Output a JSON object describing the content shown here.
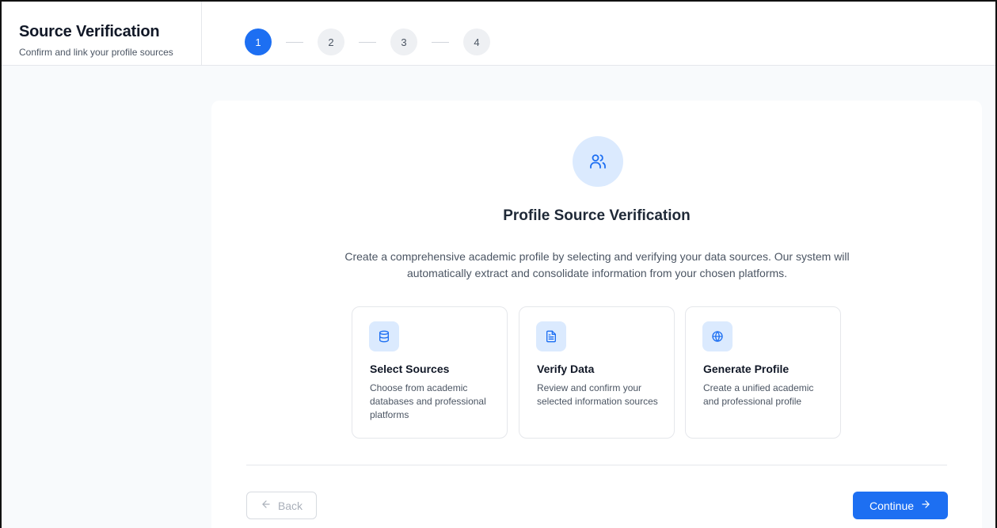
{
  "header": {
    "title": "Source Verification",
    "subtitle": "Confirm and link your profile sources"
  },
  "stepper": {
    "steps": [
      "1",
      "2",
      "3",
      "4"
    ],
    "active_step": "1"
  },
  "intro": {
    "icon": "users-icon",
    "title": "Profile Source Verification",
    "description": "Create a comprehensive academic profile by selecting and verifying your data sources. Our system will automatically extract and consolidate information from your chosen platforms."
  },
  "features": [
    {
      "icon": "database-icon",
      "title": "Select Sources",
      "description": "Choose from academic databases and professional platforms"
    },
    {
      "icon": "document-icon",
      "title": "Verify Data",
      "description": "Review and confirm your selected information sources"
    },
    {
      "icon": "globe-icon",
      "title": "Generate Profile",
      "description": "Create a unified academic and professional profile"
    }
  ],
  "actions": {
    "back_label": "Back",
    "continue_label": "Continue"
  },
  "colors": {
    "accent": "#1d6ff2",
    "icon_bg": "#dbeafe",
    "border": "#e5e7eb"
  }
}
